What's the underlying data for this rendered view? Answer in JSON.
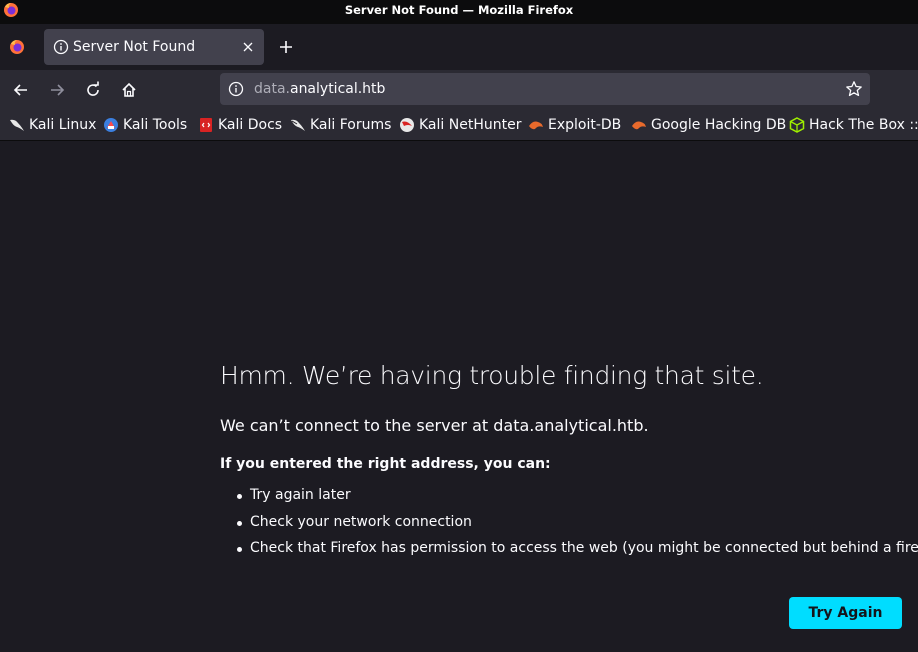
{
  "window": {
    "title": "Server Not Found — Mozilla Firefox"
  },
  "tabs": [
    {
      "label": "Server Not Found",
      "active": true
    }
  ],
  "urlbar": {
    "domain_prefix": "data.",
    "domain_main": "analytical.htb"
  },
  "bookmarks": [
    {
      "label": "Kali Linux",
      "icon": "kali-dragon-icon"
    },
    {
      "label": "Kali Tools",
      "icon": "kali-tools-icon"
    },
    {
      "label": "Kali Docs",
      "icon": "kali-docs-icon"
    },
    {
      "label": "Kali Forums",
      "icon": "kali-forums-icon"
    },
    {
      "label": "Kali NetHunter",
      "icon": "kali-nethunter-icon"
    },
    {
      "label": "Exploit-DB",
      "icon": "exploit-db-icon"
    },
    {
      "label": "Google Hacking DB",
      "icon": "exploit-db-icon"
    },
    {
      "label": "Hack The Box :: D",
      "icon": "hackthebox-icon"
    }
  ],
  "error": {
    "title": "Hmm. We’re having trouble finding that site.",
    "description": "We can’t connect to the server at data.analytical.htb.",
    "subtitle": "If you entered the right address, you can:",
    "suggestions": [
      "Try again later",
      "Check your network connection",
      "Check that Firefox has permission to access the web (you might be connected but behind a firewall)"
    ],
    "button_label": "Try Again"
  },
  "colors": {
    "accent": "#00ddff",
    "page_background": "#1c1b22",
    "toolbar_background": "#2b2a33"
  }
}
